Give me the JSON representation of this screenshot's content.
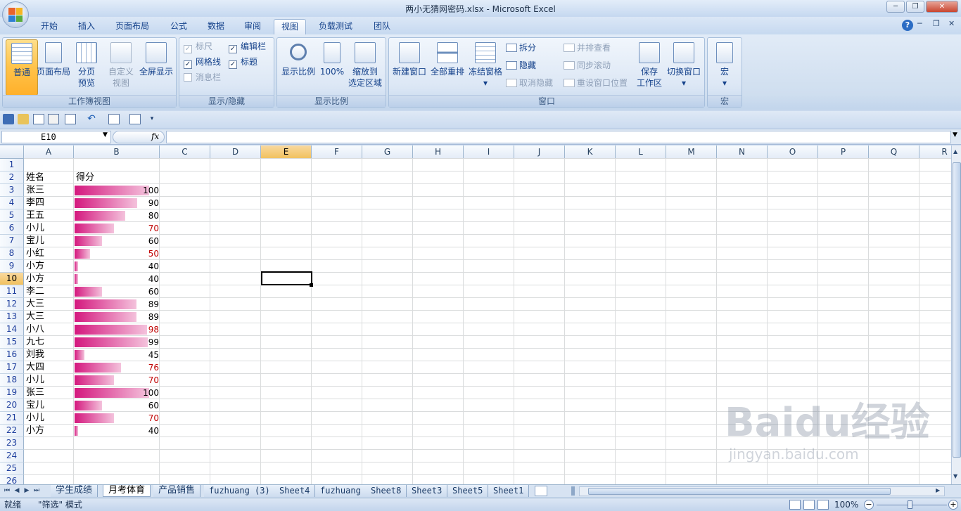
{
  "window": {
    "title": "两小无猜网密码.xlsx - Microsoft Excel",
    "controls": {
      "minimize": "─",
      "restore": "❐",
      "close": "✕"
    }
  },
  "ribbon_tabs": [
    {
      "label": "开始",
      "active": false
    },
    {
      "label": "插入",
      "active": false
    },
    {
      "label": "页面布局",
      "active": false
    },
    {
      "label": "公式",
      "active": false
    },
    {
      "label": "数据",
      "active": false
    },
    {
      "label": "审阅",
      "active": false
    },
    {
      "label": "视图",
      "active": true
    },
    {
      "label": "负载测试",
      "active": false
    },
    {
      "label": "团队",
      "active": false
    }
  ],
  "ribbon_right": {
    "help": "?",
    "min": "─",
    "restore": "❐",
    "close": "✕"
  },
  "groups": {
    "workbook_views": {
      "label": "工作簿视图",
      "normal": "普通",
      "page_layout": "页面布局",
      "page_break_1": "分页",
      "page_break_2": "预览",
      "custom_1": "自定义",
      "custom_2": "视图",
      "full_screen": "全屏显示"
    },
    "show_hide": {
      "label": "显示/隐藏",
      "ruler": "标尺",
      "formula_bar": "编辑栏",
      "gridlines": "网格线",
      "headings": "标题",
      "message_bar": "消息栏",
      "check_mark": "✓"
    },
    "zoom": {
      "label": "显示比例",
      "zoom": "显示比例",
      "hundred": "100%",
      "fit_1": "缩放到",
      "fit_2": "选定区域"
    },
    "window": {
      "label": "窗口",
      "new_window": "新建窗口",
      "arrange_all": "全部重排",
      "freeze_panes": "冻结窗格",
      "split": "拆分",
      "hide": "隐藏",
      "unhide": "取消隐藏",
      "side_by_side": "并排查看",
      "sync_scroll": "同步滚动",
      "reset_position": "重设窗口位置",
      "save_ws_1": "保存",
      "save_ws_2": "工作区",
      "switch_windows": "切换窗口",
      "dropdown": "▾"
    },
    "macros": {
      "label": "宏",
      "macros": "宏",
      "dropdown": "▾"
    }
  },
  "formula_bar": {
    "name_box": "E10",
    "fx": "fx",
    "formula": ""
  },
  "columns": [
    "A",
    "B",
    "C",
    "D",
    "E",
    "F",
    "G",
    "H",
    "I",
    "J",
    "K",
    "L",
    "M",
    "N",
    "O",
    "P",
    "Q",
    "R"
  ],
  "selected_column": "E",
  "selected_row": 10,
  "rows": [
    "1",
    "2",
    "3",
    "4",
    "5",
    "6",
    "7",
    "8",
    "9",
    "10",
    "11",
    "12",
    "13",
    "14",
    "15",
    "16",
    "17",
    "18",
    "19",
    "20",
    "21",
    "22",
    "23",
    "24",
    "25",
    "26"
  ],
  "header_row": {
    "name": "姓名",
    "score": "得分"
  },
  "records": [
    {
      "name": "张三",
      "score": "100",
      "value": 100,
      "red": false
    },
    {
      "name": "李四",
      "score": "90",
      "value": 90,
      "red": false
    },
    {
      "name": "王五",
      "score": "80",
      "value": 80,
      "red": false
    },
    {
      "name": "小儿",
      "score": "70",
      "value": 70,
      "red": true
    },
    {
      "name": "宝儿",
      "score": "60",
      "value": 60,
      "red": false
    },
    {
      "name": "小红",
      "score": "50",
      "value": 50,
      "red": true
    },
    {
      "name": "小方",
      "score": "40",
      "value": 40,
      "red": false
    },
    {
      "name": "小方",
      "score": "40",
      "value": 40,
      "red": false
    },
    {
      "name": "李二",
      "score": "60",
      "value": 60,
      "red": false
    },
    {
      "name": "大三",
      "score": "89",
      "value": 89,
      "red": false
    },
    {
      "name": "大三",
      "score": "89",
      "value": 89,
      "red": false
    },
    {
      "name": "小八",
      "score": "98",
      "value": 98,
      "red": true
    },
    {
      "name": "九七",
      "score": "99",
      "value": 99,
      "red": false
    },
    {
      "name": "刘我",
      "score": "45",
      "value": 45,
      "red": false
    },
    {
      "name": "大四",
      "score": "76",
      "value": 76,
      "red": true
    },
    {
      "name": "小儿",
      "score": "70",
      "value": 70,
      "red": true
    },
    {
      "name": "张三",
      "score": "100",
      "value": 100,
      "red": false
    },
    {
      "name": "宝儿",
      "score": "60",
      "value": 60,
      "red": false
    },
    {
      "name": "小儿",
      "score": "70",
      "value": 70,
      "red": true
    },
    {
      "name": "小方",
      "score": "40",
      "value": 40,
      "red": false
    }
  ],
  "databar_color": "#d4187e",
  "red_text_color": "#c00000",
  "sheet_tabs": [
    {
      "label": "学生成绩",
      "active": false,
      "cjk": true
    },
    {
      "label": "月考体育",
      "active": true,
      "cjk": true
    },
    {
      "label": "产品销售",
      "active": false,
      "cjk": true
    },
    {
      "label": "fuzhuang (3)",
      "active": false,
      "cjk": false
    },
    {
      "label": "Sheet4",
      "active": false,
      "cjk": false
    },
    {
      "label": "fuzhuang",
      "active": false,
      "cjk": false
    },
    {
      "label": "Sheet8",
      "active": false,
      "cjk": false
    },
    {
      "label": "Sheet3",
      "active": false,
      "cjk": false
    },
    {
      "label": "Sheet5",
      "active": false,
      "cjk": false
    },
    {
      "label": "Sheet1",
      "active": false,
      "cjk": false
    }
  ],
  "status": {
    "ready": "就绪",
    "mode": "\"筛选\" 模式",
    "zoom": "100%",
    "minus": "−",
    "plus": "+"
  },
  "watermark": {
    "brand": "Baidu经验",
    "url": "jingyan.baidu.com"
  }
}
